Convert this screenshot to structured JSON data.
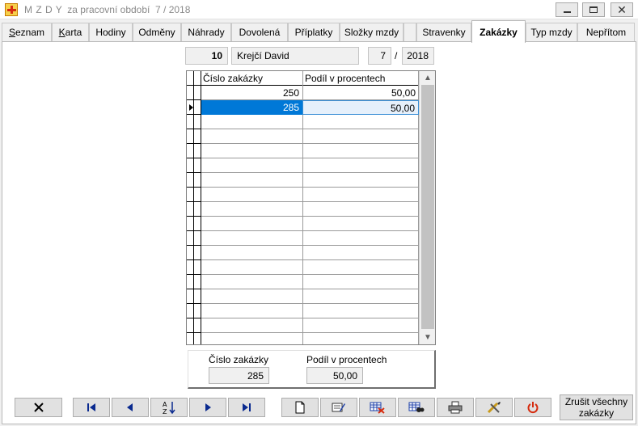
{
  "window": {
    "title_main": "M Z D Y",
    "title_sub": "za pracovní období  7 / 2018",
    "controls": {
      "minimize_icon": "minimize-icon",
      "maximize_icon": "maximize-icon",
      "close_icon": "close-icon"
    }
  },
  "tabs": [
    {
      "label": "Seznam"
    },
    {
      "label": "Karta"
    },
    {
      "label": "Hodiny"
    },
    {
      "label": "Odměny"
    },
    {
      "label": "Náhrady"
    },
    {
      "label": "Dovolená"
    },
    {
      "label": "Příplatky"
    },
    {
      "label": "Složky mzdy"
    },
    {
      "label": ""
    },
    {
      "label": "Stravenky"
    },
    {
      "label": "Zakázky"
    },
    {
      "label": "Typ mzdy"
    },
    {
      "label": "Nepřítom"
    }
  ],
  "active_tab": "Zakázky",
  "employee": {
    "number": "10",
    "name": "Krejčí David",
    "month": "7",
    "separator": "/",
    "year": "2018"
  },
  "grid": {
    "columns": [
      "Číslo zakázky",
      "Podíl v procentech"
    ],
    "rows": [
      {
        "cislo": "250",
        "podil": "50,00"
      },
      {
        "cislo": "285",
        "podil": "50,00"
      }
    ],
    "selected_row": 1
  },
  "detail": {
    "cislo_label": "Číslo zakázky",
    "cislo_value": "285",
    "podil_label": "Podíl v procentech",
    "podil_value": "50,00"
  },
  "toolbar": {
    "buttons": [
      "close-icon",
      "first-record-icon",
      "previous-record-icon",
      "sort-az-icon",
      "next-record-icon",
      "last-record-icon",
      "new-document-icon",
      "edit-icon",
      "delete-table-icon",
      "search-table-icon",
      "print-icon",
      "tools-icon",
      "power-icon"
    ],
    "cancel_all_label": "Zrušit všechny\nzakázky"
  },
  "colors": {
    "selection": "#0078d7",
    "power": "#d62b0e",
    "delete": "#d62b0e"
  }
}
